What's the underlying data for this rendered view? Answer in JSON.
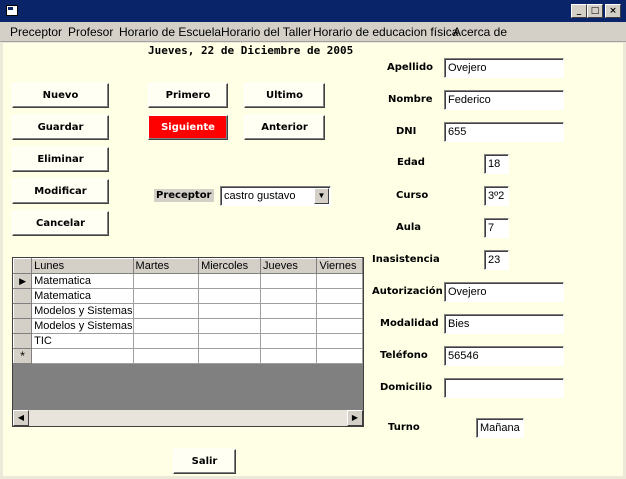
{
  "window": {
    "minimize": "_",
    "maximize": "□",
    "close": "×"
  },
  "menu": [
    "Preceptor",
    "Profesor",
    "Horario de Escuela",
    "Horario del Taller",
    "Horario de educacion física",
    "Acerca de"
  ],
  "date": "Jueves, 22 de Diciembre de 2005",
  "buttons": {
    "nuevo": "Nuevo",
    "guardar": "Guardar",
    "eliminar": "Eliminar",
    "modificar": "Modificar",
    "cancelar": "Cancelar",
    "primero": "Primero",
    "siguiente": "Siguiente",
    "ultimo": "Ultimo",
    "anterior": "Anterior",
    "salir": "Salir"
  },
  "preceptor": {
    "label": "Preceptor",
    "value": "castro gustavo"
  },
  "form": {
    "apellido": {
      "label": "Apellido",
      "value": "Ovejero"
    },
    "nombre": {
      "label": "Nombre",
      "value": "Federico"
    },
    "dni": {
      "label": "DNI",
      "value": "655"
    },
    "edad": {
      "label": "Edad",
      "value": "18"
    },
    "curso": {
      "label": "Curso",
      "value": "3º2"
    },
    "aula": {
      "label": "Aula",
      "value": "7"
    },
    "inasistencia": {
      "label": "Inasistencia",
      "value": "23"
    },
    "autorizacion": {
      "label": "Autorización",
      "value": "Ovejero"
    },
    "modalidad": {
      "label": "Modalidad",
      "value": "Bies"
    },
    "telefono": {
      "label": "Teléfono",
      "value": "56546"
    },
    "domicilio": {
      "label": "Domicilio",
      "value": ""
    },
    "turno": {
      "label": "Turno",
      "value": "Mañana"
    }
  },
  "grid": {
    "columns": [
      "Lunes",
      "Martes",
      "Miercoles",
      "Jueves",
      "Viernes"
    ],
    "rows": [
      [
        "Matematica",
        "",
        "",
        "",
        ""
      ],
      [
        "Matematica",
        "",
        "",
        "",
        ""
      ],
      [
        "Modelos y Sistemas",
        "",
        "",
        "",
        ""
      ],
      [
        "Modelos y Sistemas",
        "",
        "",
        "",
        ""
      ],
      [
        "TIC",
        "",
        "",
        "",
        ""
      ],
      [
        "",
        "",
        "",
        "",
        ""
      ]
    ],
    "current_marker": "▶",
    "new_marker": "*"
  },
  "colors": {
    "titlebar": "#0a246a",
    "background": "#ffffe6",
    "active_button": "#ff0000"
  }
}
